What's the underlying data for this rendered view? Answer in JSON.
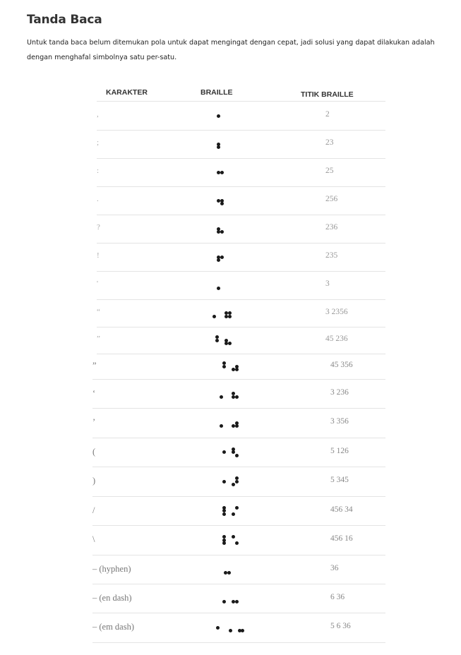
{
  "heading": "Tanda Baca",
  "intro": "Untuk tanda baca belum ditemukan pola untuk dapat mengingat dengan cepat, jadi solusi yang dapat dilakukan adalah dengan menghafal simbolnya satu per-satu.",
  "table": {
    "headers": {
      "karakter": "KARAKTER",
      "braille": "BRAILLE",
      "titik": "TITIK BRAILLE"
    },
    "rows": [
      {
        "character": ",",
        "dots": "2"
      },
      {
        "character": ";",
        "dots": "23"
      },
      {
        "character": ":",
        "dots": "25"
      },
      {
        "character": ".",
        "dots": "256"
      },
      {
        "character": "?",
        "dots": "236"
      },
      {
        "character": "!",
        "dots": "235"
      },
      {
        "character": "'",
        "dots": "3"
      },
      {
        "character": "“",
        "dots": "3 2356"
      },
      {
        "character": "”",
        "dots": "45 236"
      },
      {
        "character": "”",
        "dots": "45 356"
      },
      {
        "character": "‘",
        "dots": "3 236"
      },
      {
        "character": "’",
        "dots": "3 356"
      },
      {
        "character": "(",
        "dots": "5 126"
      },
      {
        "character": ")",
        "dots": "5 345"
      },
      {
        "character": "/",
        "dots": "456 34"
      },
      {
        "character": "\\",
        "dots": "456 16"
      },
      {
        "character": "– (hyphen)",
        "dots": "36"
      },
      {
        "character": "– (en dash)",
        "dots": "6 36"
      },
      {
        "character": "– (em dash)",
        "dots": "5 6 36"
      }
    ]
  }
}
